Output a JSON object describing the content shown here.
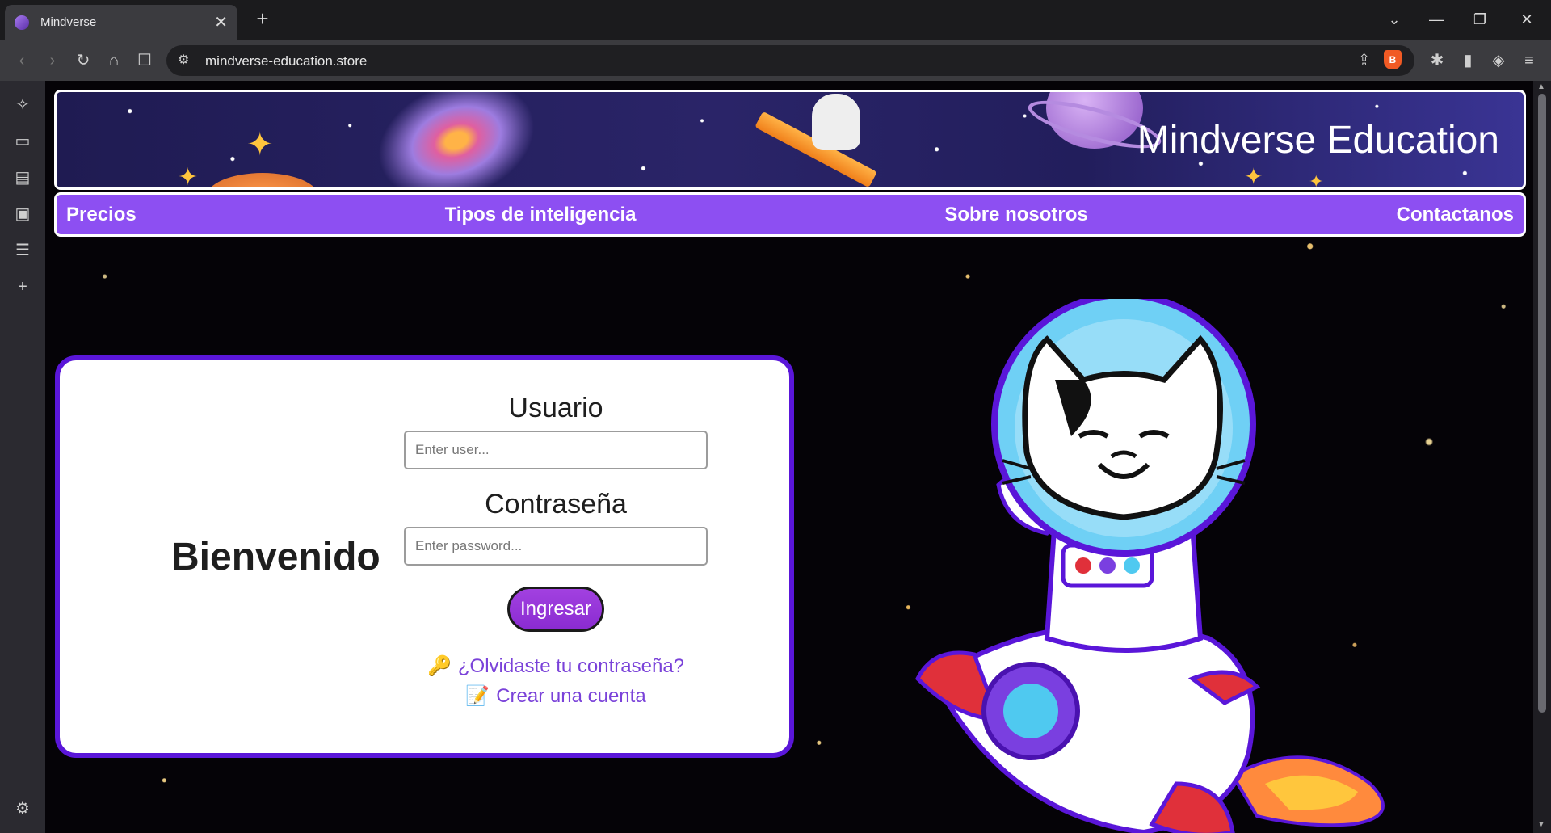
{
  "browser": {
    "tab_title": "Mindverse",
    "tab_close": "✕",
    "new_tab": "+",
    "url": "mindverse-education.store",
    "window_controls": [
      "⌄",
      "—",
      "❐",
      "✕"
    ]
  },
  "header": {
    "brand": "Mindverse Education"
  },
  "nav": {
    "items": [
      "Precios",
      "Tipos de inteligencia",
      "Sobre nosotros",
      "Contactanos"
    ]
  },
  "login": {
    "welcome": "Bienvenido",
    "user_label": "Usuario",
    "user_placeholder": "Enter user...",
    "password_label": "Contraseña",
    "password_placeholder": "Enter password...",
    "submit": "Ingresar",
    "forgot_icon": "🔑",
    "forgot": "¿Olvidaste tu contraseña?",
    "signup_icon": "📝",
    "signup": "Crear una cuenta"
  },
  "colors": {
    "nav_bg": "#8d4ff2",
    "card_border": "#5a16d9",
    "button": "#8a2bd1",
    "link": "#7a42d9"
  }
}
